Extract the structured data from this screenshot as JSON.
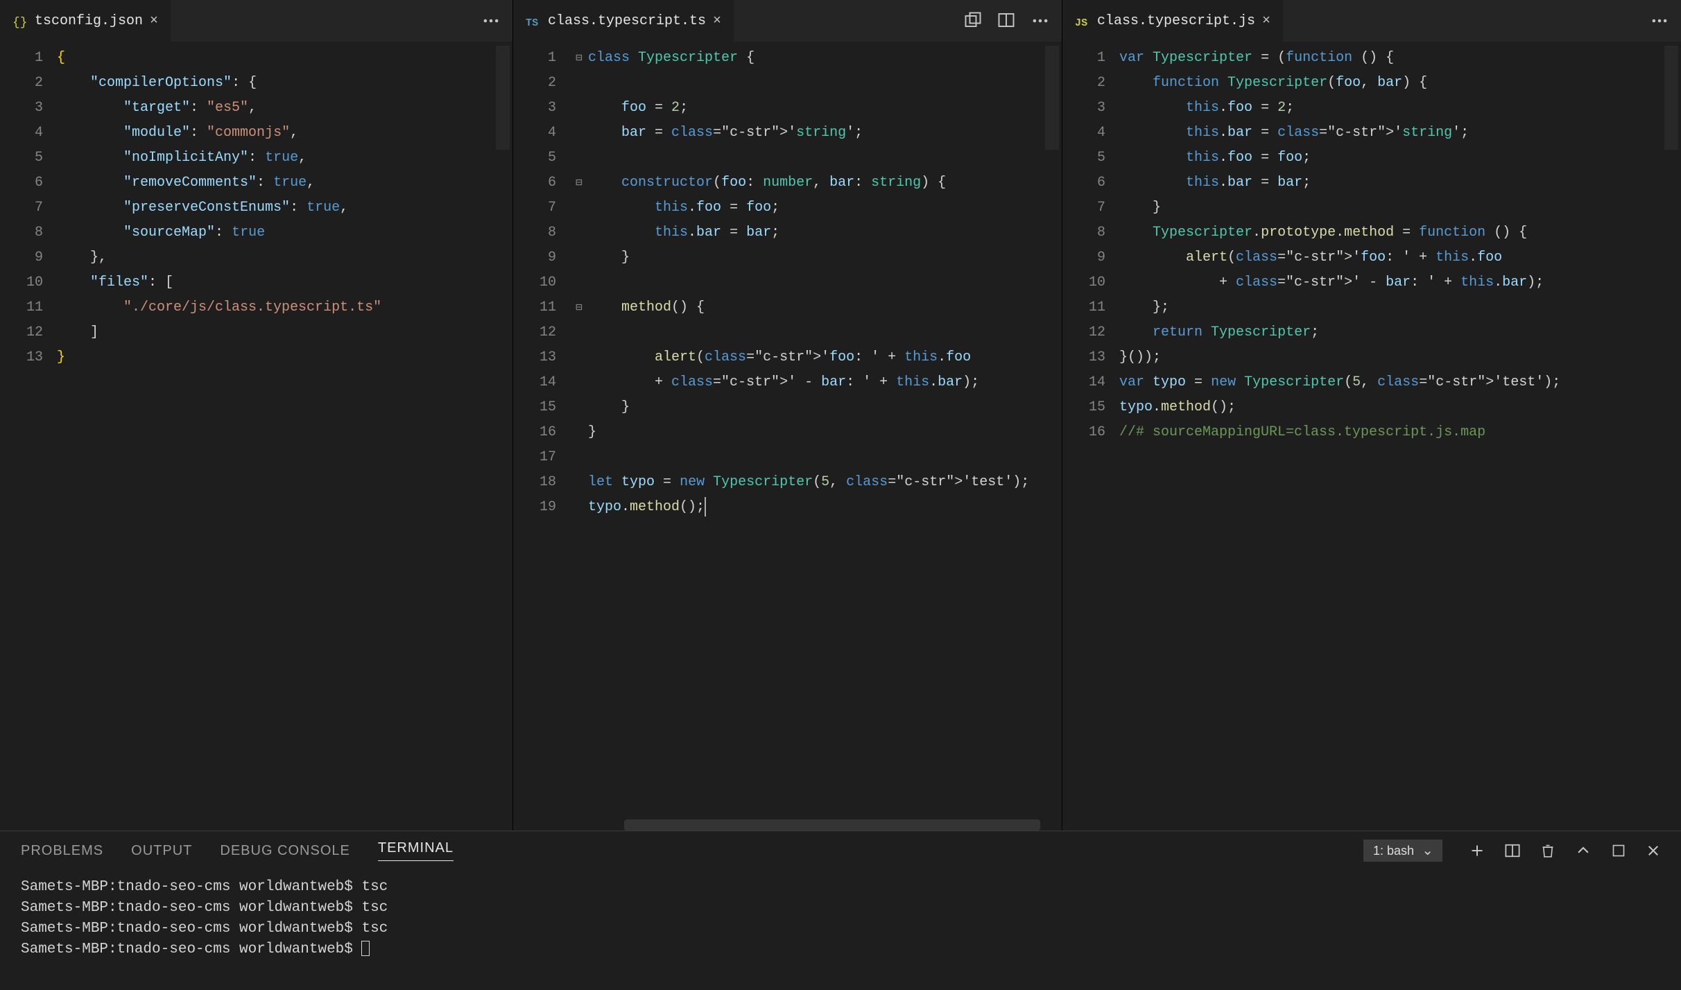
{
  "pane1": {
    "tab": {
      "label": "tsconfig.json"
    },
    "lines": [
      "{",
      "    \"compilerOptions\": {",
      "        \"target\": \"es5\",",
      "        \"module\": \"commonjs\",",
      "        \"noImplicitAny\": true,",
      "        \"removeComments\": true,",
      "        \"preserveConstEnums\": true,",
      "        \"sourceMap\": true",
      "    },",
      "    \"files\": [",
      "        \"./core/js/class.typescript.ts\"",
      "    ]",
      "}"
    ],
    "lineCount": 13
  },
  "pane2": {
    "tab": {
      "label": "class.typescript.ts"
    },
    "lines_plain": [
      "class Typescripter {",
      "",
      "    foo = 2;",
      "    bar = 'string';",
      "",
      "    constructor(foo: number, bar: string) {",
      "        this.foo = foo;",
      "        this.bar = bar;",
      "    }",
      "",
      "    method() {",
      "",
      "        alert('foo: ' + this.foo",
      "        + ' - bar: ' + this.bar);",
      "    }",
      "}",
      "",
      "let typo = new Typescripter(5, 'test');",
      "typo.method();"
    ],
    "lineCount": 19
  },
  "pane3": {
    "tab": {
      "label": "class.typescript.js"
    },
    "lines_plain": [
      "var Typescripter = (function () {",
      "    function Typescripter(foo, bar) {",
      "        this.foo = 2;",
      "        this.bar = 'string';",
      "        this.foo = foo;",
      "        this.bar = bar;",
      "    }",
      "    Typescripter.prototype.method = function () {",
      "        alert('foo: ' + this.foo",
      "            + ' - bar: ' + this.bar);",
      "    };",
      "    return Typescripter;",
      "}());",
      "var typo = new Typescripter(5, 'test');",
      "typo.method();",
      "//# sourceMappingURL=class.typescript.js.map"
    ],
    "lineCount": 16
  },
  "panel": {
    "tabs": {
      "problems": "PROBLEMS",
      "output": "OUTPUT",
      "debug": "DEBUG CONSOLE",
      "terminal": "TERMINAL"
    },
    "terminalSelect": "1: bash",
    "prompt": "Samets-MBP:tnado-seo-cms worldwantweb$",
    "cmd": "tsc"
  }
}
